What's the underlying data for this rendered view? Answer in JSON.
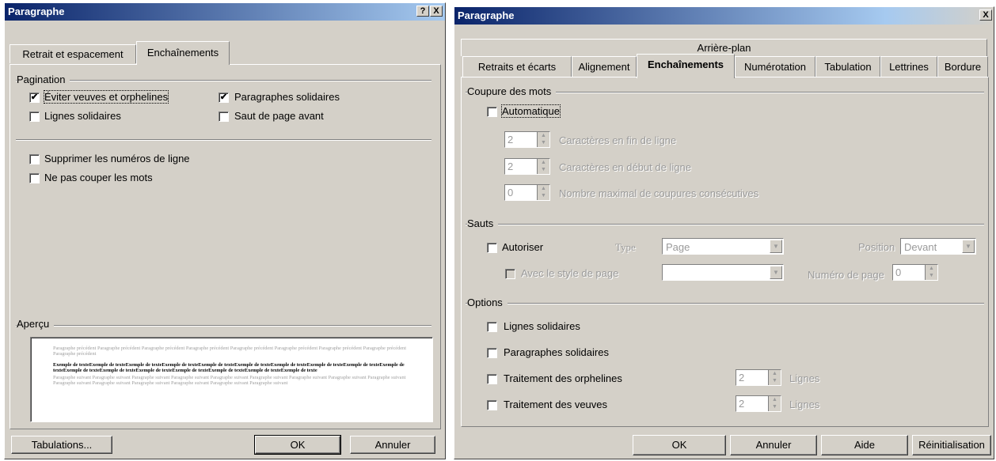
{
  "left_dialog": {
    "title": "Paragraphe",
    "help_button": "?",
    "close_button": "X",
    "tabs": [
      "Retrait et espacement",
      "Enchaînements"
    ],
    "pagination_label": "Pagination",
    "checkboxes": [
      {
        "label": "Éviter veuves et orphelines",
        "checked": true
      },
      {
        "label": "Lignes solidaires",
        "checked": false
      },
      {
        "label": "Paragraphes solidaires",
        "checked": true
      },
      {
        "label": "Saut de page avant",
        "checked": false
      },
      {
        "label": "Supprimer les numéros de ligne",
        "checked": false
      },
      {
        "label": "Ne pas couper les mots",
        "checked": false
      }
    ],
    "apercu_label": "Aperçu",
    "preview": {
      "before": "Paragraphe précédent Paragraphe précédent Paragraphe précédent Paragraphe précédent Paragraphe précédent Paragraphe précédent Paragraphe précédent Paragraphe précédent Paragraphe précédent",
      "sample": "Exemple de texteExemple de texteExemple de texteExemple de texteExemple de texteExemple de texteExemple de texteExemple de texteExemple de texteExemple de texteExemple de texteExemple de texteExemple de texteExemple de texteExemple de texteExemple de texteExemple de texte",
      "after": "Paragraphe suivant Paragraphe suivant Paragraphe suivant Paragraphe suivant Paragraphe suivant Paragraphe suivant Paragraphe suivant Paragraphe suivant Paragraphe suivant Paragraphe suivant Paragraphe suivant Paragraphe suivant Paragraphe suivant Paragraphe suivant Paragraphe suivant"
    },
    "buttons": {
      "tabs": "Tabulations...",
      "ok": "OK",
      "cancel": "Annuler"
    }
  },
  "right_dialog": {
    "title": "Paragraphe",
    "close_button": "X",
    "tab_top": "Arrière-plan",
    "tabs": [
      "Retraits et écarts",
      "Alignement",
      "Enchaînements",
      "Numérotation",
      "Tabulation",
      "Lettrines",
      "Bordure"
    ],
    "hyphen_group": "Coupure des mots",
    "automatic": "Automatique",
    "hyphen_fields": [
      {
        "value": "2",
        "label": "Caractères en fin de ligne"
      },
      {
        "value": "2",
        "label": "Caractères en début de ligne"
      },
      {
        "value": "0",
        "label": "Nombre maximal de coupures consécutives"
      }
    ],
    "breaks_group": "Sauts",
    "allow": "Autoriser",
    "type_label": "Type",
    "type_value": "Page",
    "position_label": "Position",
    "position_value": "Devant",
    "page_style": "Avec le style de page",
    "page_style_value": "",
    "page_number_label": "Numéro de page",
    "page_number_value": "0",
    "options_group": "Options",
    "keep_lines": "Lignes solidaires",
    "keep_paragraphs": "Paragraphes solidaires",
    "orphans": "Traitement des orphelines",
    "widows": "Traitement des veuves",
    "orphans_value": "2",
    "widows_value": "2",
    "lines_unit": "Lignes",
    "buttons": {
      "ok": "OK",
      "cancel": "Annuler",
      "help": "Aide",
      "reset": "Réinitialisation"
    }
  }
}
